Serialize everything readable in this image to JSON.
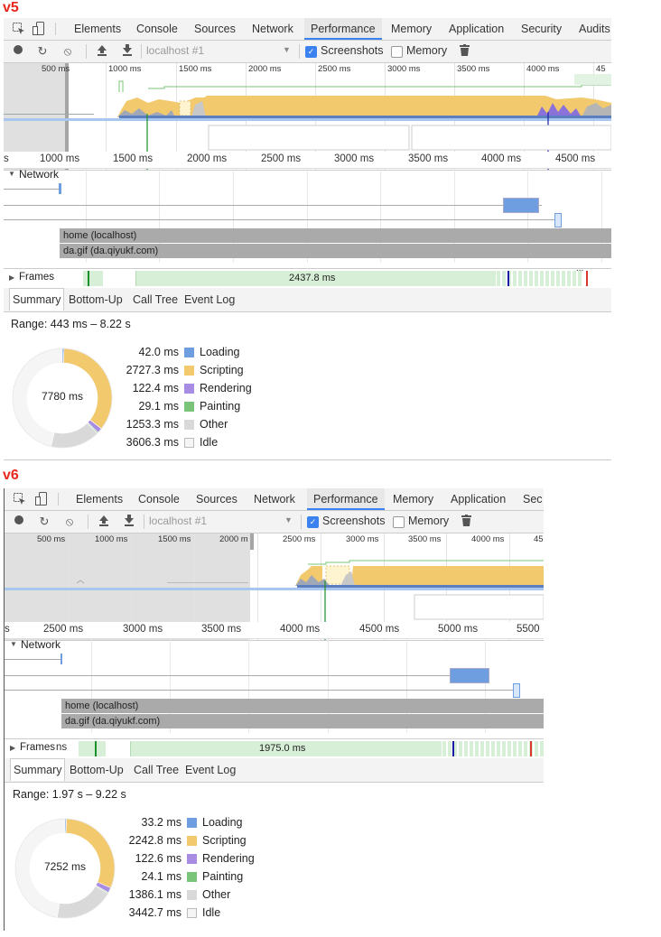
{
  "version_labels": [
    "v5",
    "v6"
  ],
  "panels": [
    {
      "tabs": [
        {
          "label": "Elements"
        },
        {
          "label": "Console"
        },
        {
          "label": "Sources"
        },
        {
          "label": "Network"
        },
        {
          "label": "Performance",
          "active": true
        },
        {
          "label": "Memory"
        },
        {
          "label": "Application"
        },
        {
          "label": "Security"
        },
        {
          "label": "Audits"
        }
      ],
      "toolbar": {
        "target_placeholder": "localhost #1",
        "screenshots_label": "Screenshots",
        "screenshots_checked": true,
        "memory_label": "Memory",
        "memory_checked": false
      },
      "overview_ticks": [
        "500 ms",
        "1000 ms",
        "1500 ms",
        "2000 ms",
        "2500 ms",
        "3000 ms",
        "3500 ms",
        "4000 ms",
        "45"
      ],
      "ruler_ticks": [
        "s",
        "1000 ms",
        "1500 ms",
        "2000 ms",
        "2500 ms",
        "3000 ms",
        "3500 ms",
        "4000 ms",
        "4500 ms"
      ],
      "network_label": "Network",
      "requests": [
        "home (localhost)",
        "da.gif (da.qiyukf.com)"
      ],
      "frames_label": "Frames",
      "frames_value": "2437.8 ms",
      "summary_tabs": [
        {
          "label": "Summary",
          "active": true
        },
        {
          "label": "Bottom-Up"
        },
        {
          "label": "Call Tree"
        },
        {
          "label": "Event Log"
        }
      ],
      "range": "Range: 443 ms – 8.22 s",
      "total": "7780 ms",
      "legend": [
        {
          "value": "42.0 ms",
          "label": "Loading",
          "color": "#6f9ee0"
        },
        {
          "value": "2727.3 ms",
          "label": "Scripting",
          "color": "#f2c96d"
        },
        {
          "value": "122.4 ms",
          "label": "Rendering",
          "color": "#a88ce3"
        },
        {
          "value": "29.1 ms",
          "label": "Painting",
          "color": "#79c479"
        },
        {
          "value": "1253.3 ms",
          "label": "Other",
          "color": "#d9d9d9"
        },
        {
          "value": "3606.3 ms",
          "label": "Idle",
          "color": "#f5f5f5"
        }
      ]
    },
    {
      "tabs": [
        {
          "label": "Elements"
        },
        {
          "label": "Console"
        },
        {
          "label": "Sources"
        },
        {
          "label": "Network"
        },
        {
          "label": "Performance",
          "active": true
        },
        {
          "label": "Memory"
        },
        {
          "label": "Application"
        },
        {
          "label": "Sec"
        }
      ],
      "toolbar": {
        "target_placeholder": "localhost #1",
        "screenshots_label": "Screenshots",
        "screenshots_checked": true,
        "memory_label": "Memory",
        "memory_checked": false
      },
      "overview_ticks": [
        "500 ms",
        "1000 ms",
        "1500 ms",
        "2000 m",
        "2500 ms",
        "3000 ms",
        "3500 ms",
        "4000 ms",
        "45"
      ],
      "ruler_ticks": [
        "s",
        "2500 ms",
        "3000 ms",
        "3500 ms",
        "4000 ms",
        "4500 ms",
        "5000 ms",
        "5500"
      ],
      "network_label": "Network",
      "requests": [
        "home (localhost)",
        "da.gif (da.qiyukf.com)"
      ],
      "frames_label": "Frames",
      "frames_suffix": "ns",
      "frames_value": "1975.0 ms",
      "summary_tabs": [
        {
          "label": "Summary",
          "active": true
        },
        {
          "label": "Bottom-Up"
        },
        {
          "label": "Call Tree"
        },
        {
          "label": "Event Log"
        }
      ],
      "range": "Range: 1.97 s – 9.22 s",
      "total": "7252 ms",
      "legend": [
        {
          "value": "33.2 ms",
          "label": "Loading",
          "color": "#6f9ee0"
        },
        {
          "value": "2242.8 ms",
          "label": "Scripting",
          "color": "#f2c96d"
        },
        {
          "value": "122.6 ms",
          "label": "Rendering",
          "color": "#a88ce3"
        },
        {
          "value": "24.1 ms",
          "label": "Painting",
          "color": "#79c479"
        },
        {
          "value": "1386.1 ms",
          "label": "Other",
          "color": "#d9d9d9"
        },
        {
          "value": "3442.7 ms",
          "label": "Idle",
          "color": "#f5f5f5"
        }
      ]
    }
  ]
}
